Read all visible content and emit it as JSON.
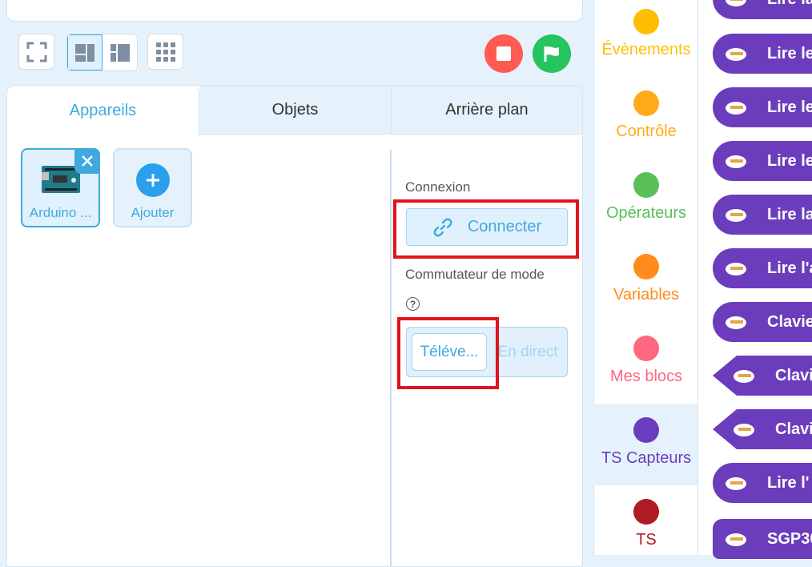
{
  "toolbar": {
    "fullscreen_icon": "fullscreen-icon",
    "layout_icons": [
      "layout-split-icon",
      "layout-narrow-icon"
    ],
    "grid_icon": "grid-icon",
    "stop_color": "#ff5b53",
    "go_color": "#25c45f"
  },
  "tabs": [
    {
      "label": "Appareils"
    },
    {
      "label": "Objets"
    },
    {
      "label": "Arrière plan"
    }
  ],
  "devices": {
    "selected_name": "Arduino ...",
    "add_label": "Ajouter"
  },
  "settings": {
    "connection_label": "Connexion",
    "connect_button": "Connecter",
    "mode_switch_label": "Commutateur de mode",
    "mode_upload": "Téléve...",
    "mode_live": "En direct"
  },
  "categories": [
    {
      "name": "Évènements",
      "color": "#ffbf00"
    },
    {
      "name": "Contrôle",
      "color": "#ffab19"
    },
    {
      "name": "Opérateurs",
      "color": "#59c059"
    },
    {
      "name": "Variables",
      "color": "#ff8c1a"
    },
    {
      "name": "Mes blocs",
      "color": "#ff6680"
    },
    {
      "name": "TS Capteurs",
      "color": "#6b3dbd"
    },
    {
      "name": "TS",
      "color": "#b01c23"
    }
  ],
  "blocks": [
    {
      "text": "Lire la"
    },
    {
      "text": "Lire le"
    },
    {
      "text": "Lire le"
    },
    {
      "text": "Lire le"
    },
    {
      "text": "Lire la"
    },
    {
      "text": "Lire l'a"
    },
    {
      "text": "Clavie"
    },
    {
      "text": "Clavi"
    },
    {
      "text": "Clavi"
    },
    {
      "text": "Lire l'"
    },
    {
      "text": "SGP30"
    }
  ]
}
